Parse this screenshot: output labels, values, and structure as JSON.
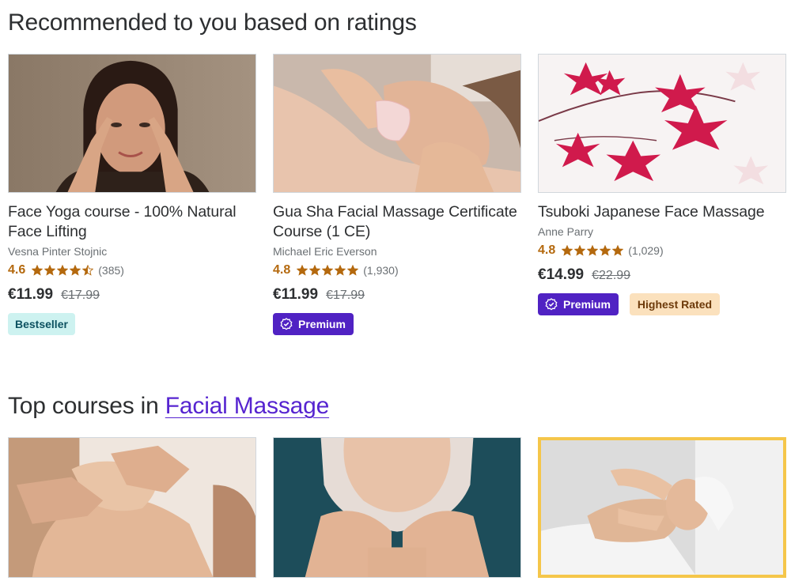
{
  "section1": {
    "title": "Recommended to you based on ratings"
  },
  "section2": {
    "title_prefix": "Top courses in ",
    "title_link": "Facial Massage"
  },
  "cards": [
    {
      "title": "Face Yoga course - 100% Natural Face Lifting",
      "instructor": "Vesna Pinter Stojnic",
      "rating": "4.6",
      "stars": 4.6,
      "reviews": "(385)",
      "price": "€11.99",
      "old_price": "€17.99",
      "badges": [
        {
          "type": "bestseller",
          "label": "Bestseller"
        }
      ]
    },
    {
      "title": "Gua Sha Facial Massage Certificate Course (1 CE)",
      "instructor": "Michael Eric Everson",
      "rating": "4.8",
      "stars": 4.8,
      "reviews": "(1,930)",
      "price": "€11.99",
      "old_price": "€17.99",
      "badges": [
        {
          "type": "premium",
          "label": "Premium"
        }
      ]
    },
    {
      "title": "Tsuboki Japanese Face Massage",
      "instructor": "Anne Parry",
      "rating": "4.8",
      "stars": 4.8,
      "reviews": "(1,029)",
      "price": "€14.99",
      "old_price": "€22.99",
      "badges": [
        {
          "type": "premium",
          "label": "Premium"
        },
        {
          "type": "highest",
          "label": "Highest Rated"
        }
      ]
    }
  ],
  "colors": {
    "star": "#b4690e",
    "premium": "#5022c3",
    "link": "#5624d0",
    "bestseller_bg": "#cdf2f0",
    "highest_bg": "#fbe1bd"
  }
}
